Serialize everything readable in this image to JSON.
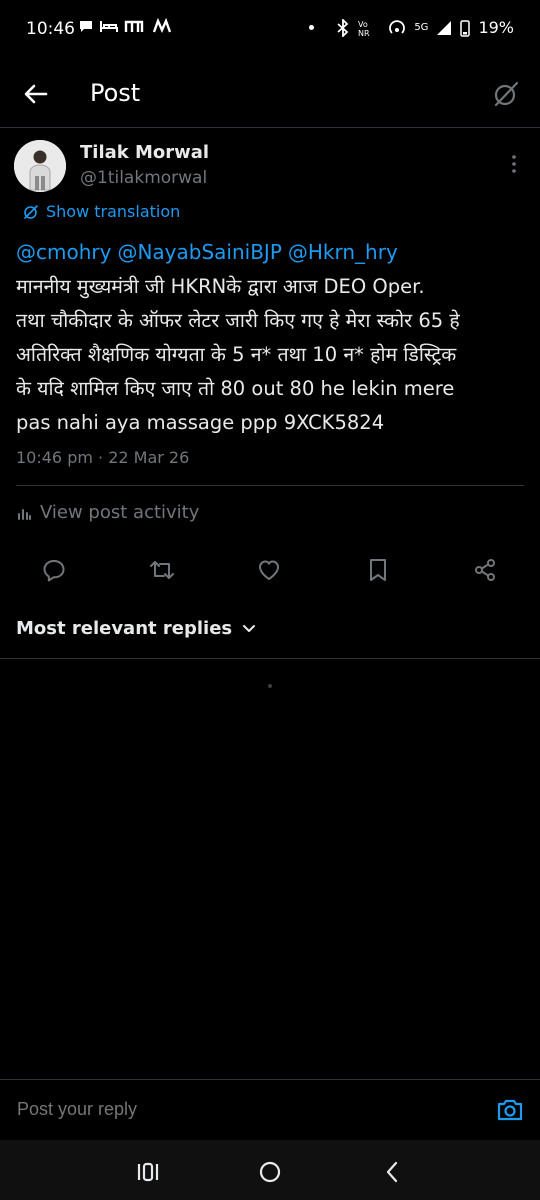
{
  "status_bar": {
    "time": "10:46",
    "network": "5G",
    "battery": "19%"
  },
  "header": {
    "title": "Post"
  },
  "post": {
    "author_name": "Tilak Morwal",
    "author_handle": "@1tilakmorwal",
    "translate_label": "Show translation",
    "mentions": [
      "@cmohry",
      "@NayabSainiBJP",
      "@Hkrn_hry"
    ],
    "body_lines": [
      "माननीय मुख्यमंत्री जी HKRNके द्वारा आज DEO Oper.",
      "तथा चौकीदार के ऑफर लेटर जारी किए गए हे मेरा स्कोर 65 हे",
      "अतिरिक्त शैक्षणिक योग्यता के 5 न* तथा 10 न* होम डिस्ट्रिक",
      "के यदि शामिल किए जाए तो 80 out 80 he lekin mere",
      "pas nahi aya  massage ppp 9XCK5824"
    ],
    "timestamp": "10:46 pm · 22 Mar 26",
    "activity_label": "View post activity"
  },
  "replies": {
    "sort_label": "Most relevant replies"
  },
  "reply_bar": {
    "placeholder": "Post your reply"
  },
  "colors": {
    "accent": "#1d9bf0",
    "secondary_text": "#71767b",
    "divider": "#2f3336"
  },
  "icons": {
    "back": "arrow-left-icon",
    "grok": "grok-icon",
    "more": "more-vertical-icon",
    "translate": "grok-icon",
    "activity": "bar-chart-icon",
    "reply": "reply-icon",
    "repost": "repost-icon",
    "like": "heart-icon",
    "bookmark": "bookmark-icon",
    "share": "share-icon",
    "chevron": "chevron-down-icon",
    "camera": "camera-icon",
    "recents": "recents-icon",
    "home": "home-icon",
    "nav_back": "nav-back-icon"
  }
}
